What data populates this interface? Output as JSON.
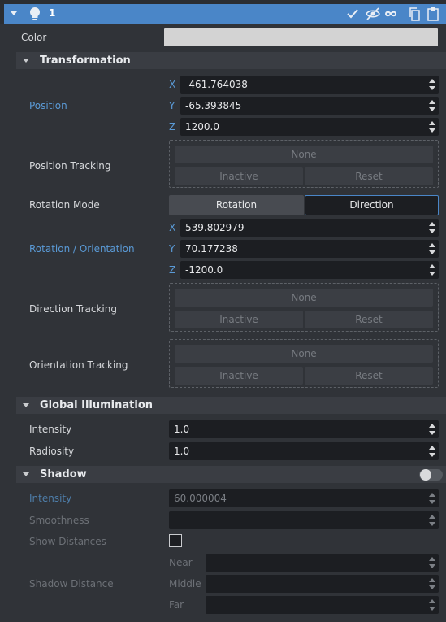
{
  "header": {
    "title": "1"
  },
  "color": {
    "label": "Color",
    "swatch": "#d3d3d3"
  },
  "transformation": {
    "title": "Transformation",
    "position": {
      "label": "Position",
      "x": "-461.764038",
      "y": "-65.393845",
      "z": "1200.0"
    },
    "position_tracking": {
      "label": "Position Tracking",
      "none": "None",
      "inactive": "Inactive",
      "reset": "Reset"
    },
    "rotation_mode": {
      "label": "Rotation Mode",
      "options": [
        "Rotation",
        "Direction"
      ],
      "selected": "Direction"
    },
    "rotation": {
      "label": "Rotation / Orientation",
      "x": "539.802979",
      "y": "70.177238",
      "z": "-1200.0"
    },
    "direction_tracking": {
      "label": "Direction Tracking",
      "none": "None",
      "inactive": "Inactive",
      "reset": "Reset"
    },
    "orientation_tracking": {
      "label": "Orientation Tracking",
      "none": "None",
      "inactive": "Inactive",
      "reset": "Reset"
    }
  },
  "axes": {
    "x": "X",
    "y": "Y",
    "z": "Z"
  },
  "global_illumination": {
    "title": "Global Illumination",
    "intensity": {
      "label": "Intensity",
      "value": "1.0"
    },
    "radiosity": {
      "label": "Radiosity",
      "value": "1.0"
    }
  },
  "shadow": {
    "title": "Shadow",
    "enabled": false,
    "intensity": {
      "label": "Intensity",
      "value": "60.000004"
    },
    "smoothness": {
      "label": "Smoothness",
      "value": ""
    },
    "show_distances": {
      "label": "Show Distances",
      "checked": false
    },
    "distance": {
      "label": "Shadow Distance",
      "near": "Near",
      "middle": "Middle",
      "far": "Far"
    }
  },
  "colors": {
    "accent": "#4a86c8",
    "label_blue": "#5a9ad6",
    "background": "#2b2e33"
  }
}
